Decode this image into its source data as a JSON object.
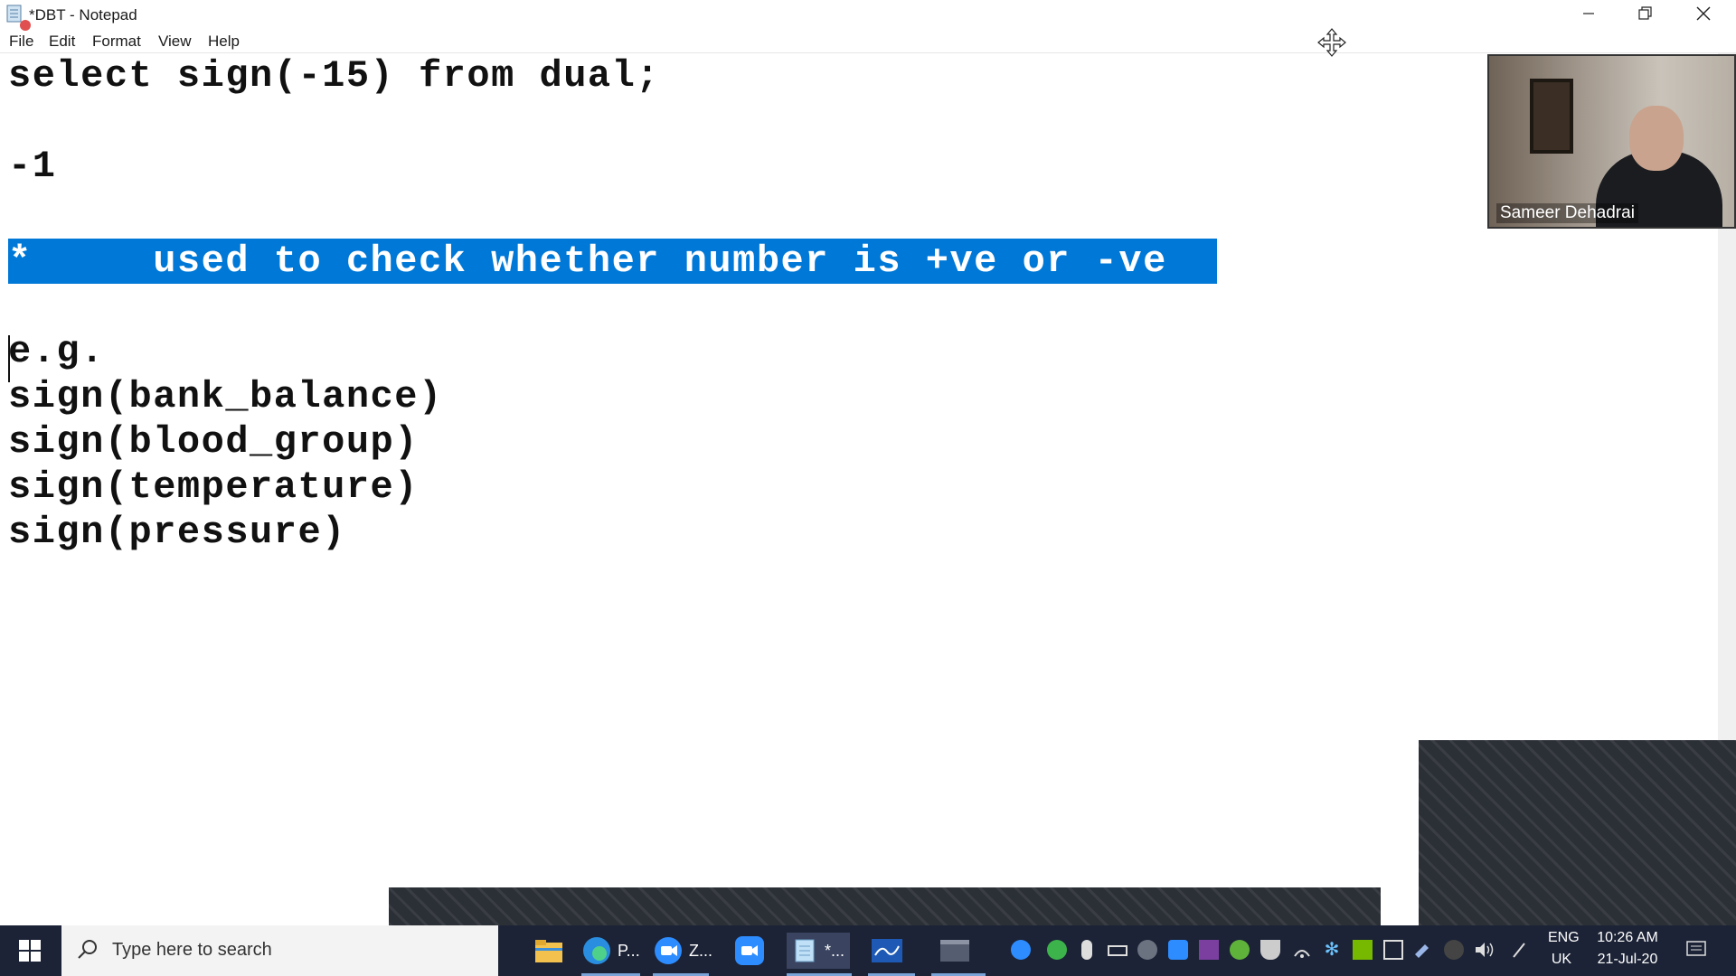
{
  "window": {
    "title": "*DBT - Notepad",
    "menu": [
      "File",
      "Edit",
      "Format",
      "View",
      "Help"
    ]
  },
  "editor": {
    "lines": [
      "select sign(-15) from dual;",
      "",
      "-1",
      "",
      "*     used to check whether number is +ve or -ve",
      "",
      "e.g.",
      "sign(bank_balance)",
      "sign(blood_group)",
      "sign(temperature)",
      "sign(pressure)"
    ],
    "selected_line_index": 4,
    "selection_color": "#0078d7"
  },
  "video": {
    "participant_name": "Sameer Dehadrai"
  },
  "taskbar": {
    "search_placeholder": "Type here to search",
    "apps": [
      {
        "name": "file-explorer",
        "label": ""
      },
      {
        "name": "edge",
        "label": "P..."
      },
      {
        "name": "zoom",
        "label": "Z..."
      },
      {
        "name": "zoom-meeting",
        "label": ""
      },
      {
        "name": "notepad",
        "label": "*..."
      },
      {
        "name": "whiteboard",
        "label": ""
      },
      {
        "name": "terminal",
        "label": ""
      }
    ],
    "language": "ENG",
    "region": "UK",
    "time": "10:26 AM",
    "date": "21-Jul-20",
    "accent": "#1c2336"
  }
}
